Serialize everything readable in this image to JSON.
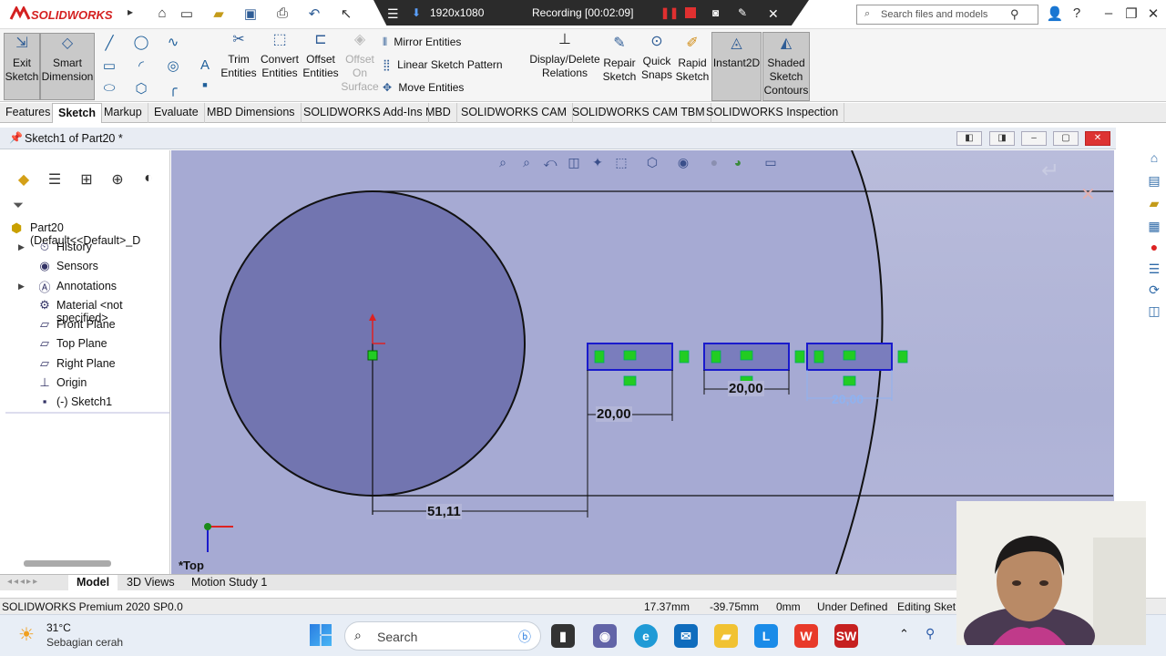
{
  "app": {
    "name": "SOLIDWORKS",
    "window_title": "Sketch1 of Part20 *"
  },
  "recording": {
    "resolution": "1920x1080",
    "status": "Recording [00:02:09]"
  },
  "search": {
    "placeholder": "Search files and models"
  },
  "ribbon": {
    "exit_sketch": "Exit Sketch",
    "smart_dimension": "Smart Dimension",
    "trim_entities": "Trim Entities",
    "convert_entities": "Convert Entities",
    "offset_entities": "Offset Entities",
    "offset_on_surface": "Offset On Surface",
    "mirror_entities": "Mirror Entities",
    "linear_sketch_pattern": "Linear Sketch Pattern",
    "move_entities": "Move Entities",
    "display_delete_relations": "Display/Delete Relations",
    "repair_sketch": "Repair Sketch",
    "quick_snaps": "Quick Snaps",
    "rapid_sketch": "Rapid Sketch",
    "instant2d": "Instant2D",
    "shaded_sketch_contours": "Shaded Sketch Contours"
  },
  "tabs": [
    "Features",
    "Sketch",
    "Markup",
    "Evaluate",
    "MBD Dimensions",
    "SOLIDWORKS Add-Ins",
    "MBD",
    "SOLIDWORKS CAM",
    "SOLIDWORKS CAM TBM",
    "SOLIDWORKS Inspection"
  ],
  "active_tab": "Sketch",
  "tree": {
    "root": "Part20  (Default<<Default>_D",
    "items": [
      "History",
      "Sensors",
      "Annotations",
      "Material <not specified>",
      "Front Plane",
      "Top Plane",
      "Right Plane",
      "Origin",
      "(-) Sketch1"
    ]
  },
  "sketch": {
    "dim_width": "20,00",
    "dim_width_2": "20,00",
    "dim_width_3": "20,00",
    "dim_offset": "51,11",
    "view_label": "*Top"
  },
  "bottom_tabs": [
    "Model",
    "3D Views",
    "Motion Study 1"
  ],
  "status": {
    "product": "SOLIDWORKS Premium 2020 SP0.0",
    "x": "17.37mm",
    "y": "-39.75mm",
    "z": "0mm",
    "state": "Under Defined",
    "mode": "Editing Sket"
  },
  "taskbar": {
    "temperature": "31°C",
    "weather": "Sebagian cerah",
    "search": "Search"
  },
  "colors": {
    "viewport": "#b3b6d8",
    "disc": "#7275b0",
    "sketch_blue": "#1a1acc",
    "relation_green": "#22cc22"
  }
}
